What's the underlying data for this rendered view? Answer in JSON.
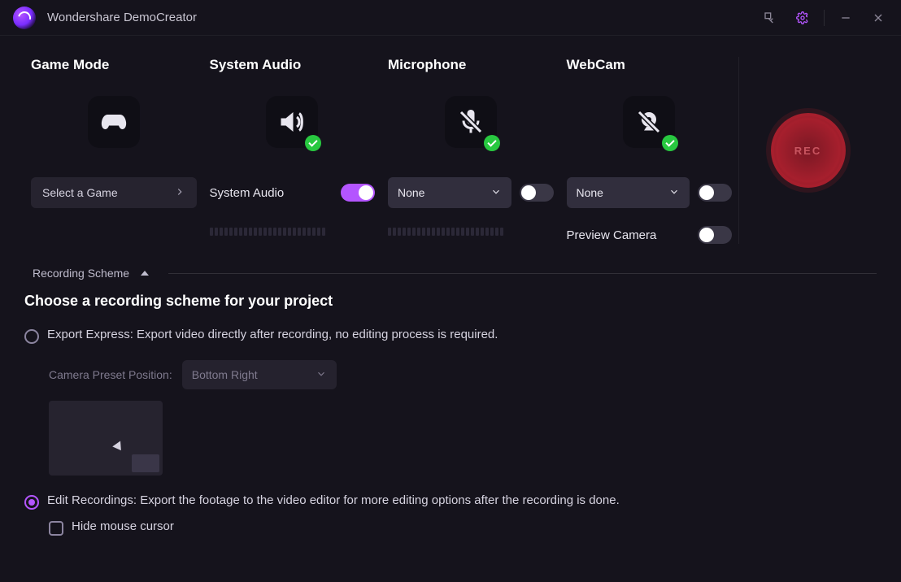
{
  "titlebar": {
    "app_name": "Wondershare DemoCreator"
  },
  "options": {
    "game": {
      "title": "Game Mode",
      "select_label": "Select a Game"
    },
    "audio": {
      "title": "System Audio",
      "label": "System Audio",
      "enabled": true
    },
    "mic": {
      "title": "Microphone",
      "selected": "None",
      "enabled": false
    },
    "webcam": {
      "title": "WebCam",
      "selected": "None",
      "enabled": false,
      "preview_label": "Preview Camera",
      "preview_on": false
    },
    "rec_label": "REC"
  },
  "scheme": {
    "section_label": "Recording Scheme",
    "heading": "Choose a recording scheme for your project",
    "express": "Export Express: Export video directly after recording, no editing process is required.",
    "camera_pos_label": "Camera Preset Position:",
    "camera_pos_value": "Bottom Right",
    "edit": "Edit Recordings: Export the footage to the video editor for more editing options after the recording is done.",
    "hide_cursor": "Hide mouse cursor"
  }
}
